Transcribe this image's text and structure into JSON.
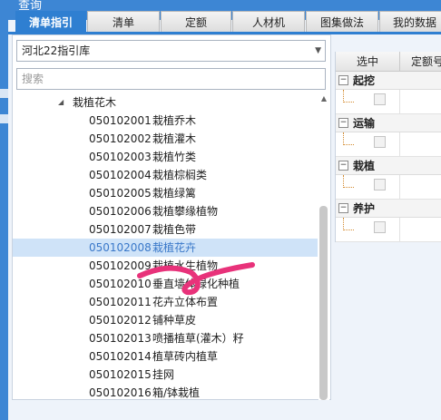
{
  "window": {
    "title": "查询"
  },
  "tabs": [
    {
      "label": "清单指引",
      "active": true
    },
    {
      "label": "清单"
    },
    {
      "label": "定额"
    },
    {
      "label": "人材机"
    },
    {
      "label": "图集做法"
    },
    {
      "label": "我的数据"
    }
  ],
  "library_select": {
    "value": "河北22指引库"
  },
  "search": {
    "placeholder": "搜索"
  },
  "tree": {
    "parent_label": "栽植花木",
    "items": [
      {
        "code": "050102001",
        "name": "栽植乔木"
      },
      {
        "code": "050102002",
        "name": "栽植灌木"
      },
      {
        "code": "050102003",
        "name": "栽植竹类"
      },
      {
        "code": "050102004",
        "name": "栽植棕榈类"
      },
      {
        "code": "050102005",
        "name": "栽植绿篱"
      },
      {
        "code": "050102006",
        "name": "栽植攀缘植物"
      },
      {
        "code": "050102007",
        "name": "栽植色带"
      },
      {
        "code": "050102008",
        "name": "栽植花卉",
        "selected": true
      },
      {
        "code": "050102009",
        "name": "栽植水生植物"
      },
      {
        "code": "050102010",
        "name": "垂直墙体绿化种植"
      },
      {
        "code": "050102011",
        "name": "花卉立体布置"
      },
      {
        "code": "050102012",
        "name": "铺种草皮"
      },
      {
        "code": "050102013",
        "name": "喷播植草(灌木）籽"
      },
      {
        "code": "050102014",
        "name": "植草砖内植草"
      },
      {
        "code": "050102015",
        "name": "挂网"
      },
      {
        "code": "050102016",
        "name": "箱/钵栽植"
      }
    ]
  },
  "grid": {
    "columns": [
      "选中",
      "定额号"
    ],
    "groups": [
      {
        "name": "起挖",
        "toggle": "−"
      },
      {
        "name": "运输",
        "toggle": "−"
      },
      {
        "name": "栽植",
        "toggle": "−"
      },
      {
        "name": "养护",
        "toggle": "−"
      }
    ]
  },
  "colors": {
    "accent": "#2f7fd1",
    "titlebar": "#3d86d4",
    "selection": "#cfe3f8",
    "annotation": "#e8327a"
  }
}
